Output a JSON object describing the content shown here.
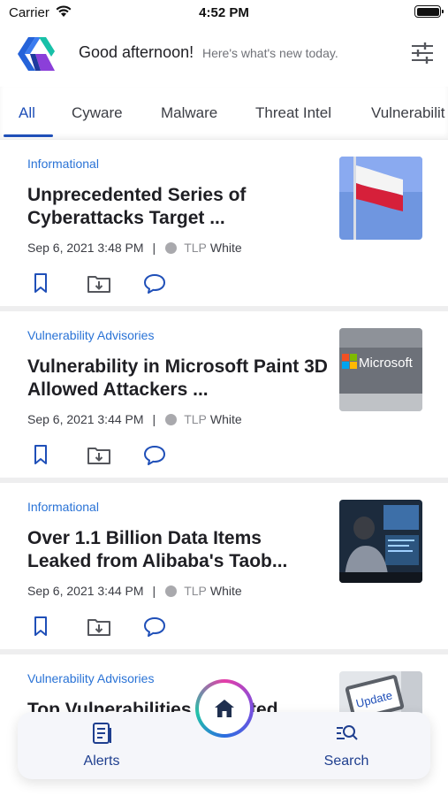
{
  "status_bar": {
    "carrier": "Carrier",
    "time": "4:52 PM",
    "battery_level": 1.0
  },
  "header": {
    "greeting": "Good afternoon!",
    "subtitle": "Here's what's new today.",
    "logo_icon": "cyware-logo",
    "filter_icon": "sliders-icon"
  },
  "tabs": [
    {
      "label": "All",
      "active": true
    },
    {
      "label": "Cyware",
      "active": false
    },
    {
      "label": "Malware",
      "active": false
    },
    {
      "label": "Threat Intel",
      "active": false
    },
    {
      "label": "Vulnerabilit",
      "active": false
    }
  ],
  "feed": [
    {
      "category": "Informational",
      "title": "Unprecedented Series of Cyberattacks Target ...",
      "date": "Sep 6, 2021 3:48 PM",
      "tlp_label": "TLP",
      "tlp_value": "White",
      "thumbnail": "polish-flag-photo"
    },
    {
      "category": "Vulnerability Advisories",
      "title": "Vulnerability in Microsoft Paint 3D Allowed Attackers ...",
      "date": "Sep 6, 2021 3:44 PM",
      "tlp_label": "TLP",
      "tlp_value": "White",
      "thumbnail": "microsoft-building-photo",
      "thumbnail_text": "Microsoft"
    },
    {
      "category": "Informational",
      "title": "Over 1.1 Billion Data Items Leaked from Alibaba's Taob...",
      "date": "Sep 6, 2021 3:44 PM",
      "tlp_label": "TLP",
      "tlp_value": "White",
      "thumbnail": "person-at-computer-photo"
    },
    {
      "category": "Vulnerability Advisories",
      "title": "Top Vulnerabilities Reported",
      "date": "",
      "tlp_label": "",
      "tlp_value": "",
      "thumbnail": "update-screen-photo",
      "thumbnail_text": "Update"
    }
  ],
  "bottom_nav": {
    "alerts_label": "Alerts",
    "search_label": "Search",
    "home_icon": "home-icon"
  },
  "colors": {
    "accent": "#1f4fb8",
    "category": "#2a73d6",
    "nav_text": "#1f3f8f"
  }
}
